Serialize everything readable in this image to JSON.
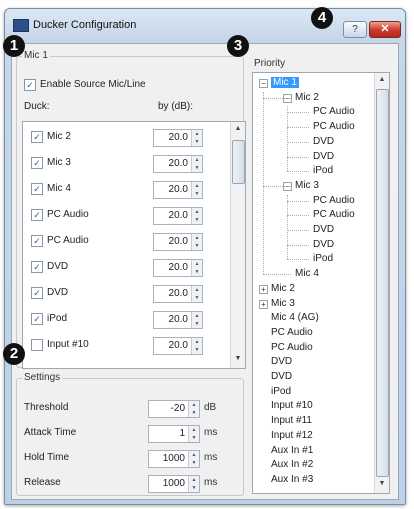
{
  "window": {
    "title": "Ducker Configuration",
    "help_label": "?",
    "close_label": "✕"
  },
  "badges": [
    "1",
    "2",
    "3",
    "4"
  ],
  "mic_group": {
    "label": "Mic 1",
    "enable_label": "Enable Source Mic/Line",
    "duck_header": "Duck:",
    "by_header": "by (dB):",
    "rows": [
      {
        "label": "Mic 2",
        "checked": true,
        "value": "20.0"
      },
      {
        "label": "Mic 3",
        "checked": true,
        "value": "20.0"
      },
      {
        "label": "Mic 4",
        "checked": true,
        "value": "20.0"
      },
      {
        "label": "PC Audio",
        "checked": true,
        "value": "20.0"
      },
      {
        "label": "PC Audio",
        "checked": true,
        "value": "20.0"
      },
      {
        "label": "DVD",
        "checked": true,
        "value": "20.0"
      },
      {
        "label": "DVD",
        "checked": true,
        "value": "20.0"
      },
      {
        "label": "iPod",
        "checked": true,
        "value": "20.0"
      },
      {
        "label": "Input #10",
        "checked": false,
        "value": "20.0"
      }
    ]
  },
  "settings": {
    "label": "Settings",
    "rows": [
      {
        "label": "Threshold",
        "value": "-20",
        "unit": "dB"
      },
      {
        "label": "Attack Time",
        "value": "1",
        "unit": "ms"
      },
      {
        "label": "Hold Time",
        "value": "1000",
        "unit": "ms"
      },
      {
        "label": "Release",
        "value": "1000",
        "unit": "ms"
      }
    ]
  },
  "priority": {
    "label": "Priority",
    "items": [
      {
        "label": "Mic 1",
        "level": 0,
        "expander": "−",
        "selected": true
      },
      {
        "label": "Mic 2",
        "level": 1,
        "expander": "−"
      },
      {
        "label": "PC Audio",
        "level": 2
      },
      {
        "label": "PC Audio",
        "level": 2
      },
      {
        "label": "DVD",
        "level": 2
      },
      {
        "label": "DVD",
        "level": 2
      },
      {
        "label": "iPod",
        "level": 2
      },
      {
        "label": "Mic 3",
        "level": 1,
        "expander": "−"
      },
      {
        "label": "PC Audio",
        "level": 2
      },
      {
        "label": "PC Audio",
        "level": 2
      },
      {
        "label": "DVD",
        "level": 2
      },
      {
        "label": "DVD",
        "level": 2
      },
      {
        "label": "iPod",
        "level": 2
      },
      {
        "label": "Mic 4",
        "level": 1
      },
      {
        "label": "Mic 2",
        "level": 0,
        "expander": "+"
      },
      {
        "label": "Mic 3",
        "level": 0,
        "expander": "+"
      },
      {
        "label": "Mic 4 (AG)",
        "level": 0
      },
      {
        "label": "PC Audio",
        "level": 0
      },
      {
        "label": "PC Audio",
        "level": 0
      },
      {
        "label": "DVD",
        "level": 0
      },
      {
        "label": "DVD",
        "level": 0
      },
      {
        "label": "iPod",
        "level": 0
      },
      {
        "label": "Input #10",
        "level": 0
      },
      {
        "label": "Input #11",
        "level": 0
      },
      {
        "label": "Input #12",
        "level": 0
      },
      {
        "label": "Aux In #1",
        "level": 0
      },
      {
        "label": "Aux In #2",
        "level": 0
      },
      {
        "label": "Aux In #3",
        "level": 0
      }
    ]
  },
  "icons": {
    "check": "checkmark-icon",
    "spin": "spin-arrows-icon",
    "scroll_up": "scroll-up-icon",
    "scroll_down": "scroll-down-icon"
  },
  "colors": {
    "selection": "#3399ff",
    "close": "#c9382a",
    "checkmark": "#2b5fa8"
  }
}
